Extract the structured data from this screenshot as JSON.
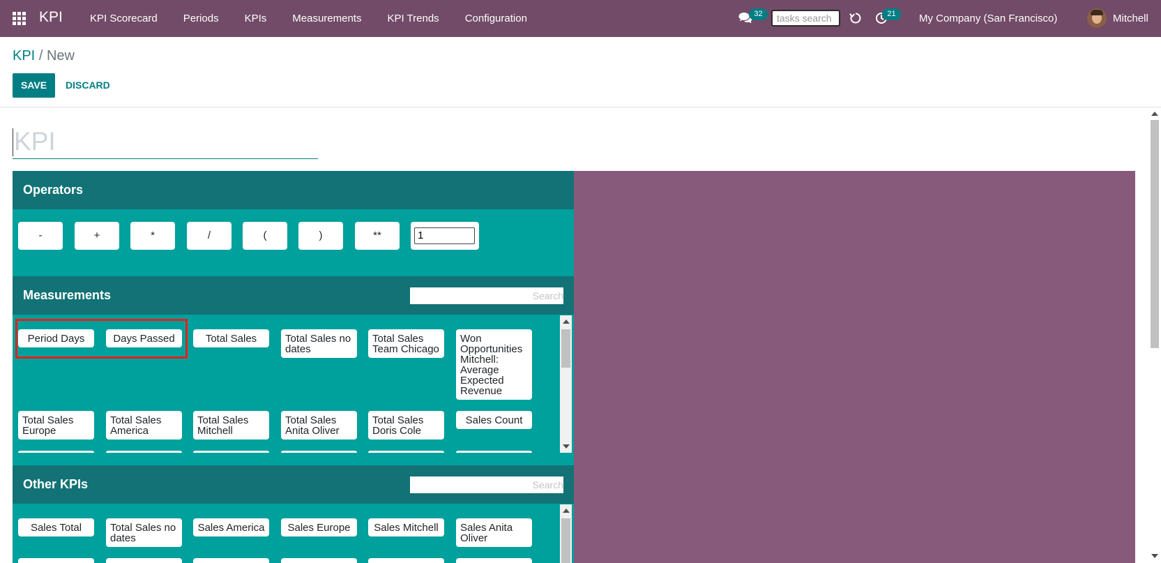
{
  "navbar": {
    "brand": "KPI",
    "menu": [
      "KPI Scorecard",
      "Periods",
      "KPIs",
      "Measurements",
      "KPI Trends",
      "Configuration"
    ],
    "messages_count": "32",
    "tasks_search_placeholder": "tasks search",
    "activities_count": "21",
    "company": "My Company (San Francisco)",
    "user": "Mitchell"
  },
  "breadcrumb": {
    "parent": "KPI",
    "separator": "/",
    "current": "New"
  },
  "buttons": {
    "save": "SAVE",
    "discard": "DISCARD"
  },
  "form": {
    "name_placeholder": "KPI"
  },
  "operators": {
    "title": "Operators",
    "buttons": [
      "-",
      "+",
      "*",
      "/",
      "(",
      ")",
      "**"
    ],
    "number_value": "1"
  },
  "measurements": {
    "title": "Measurements",
    "search_placeholder": "Search",
    "items": [
      "Period Days",
      "Days Passed",
      "Total Sales",
      "Total Sales no dates",
      "Total Sales Team Chicago",
      "Won Opportunities Mitchell: Average Expected Revenue",
      "Total Sales Europe",
      "Total Sales America",
      "Total Sales Mitchell",
      "Total Sales Anita Oliver",
      "Total Sales Doris Cole",
      "Sales Count"
    ]
  },
  "other_kpis": {
    "title": "Other KPIs",
    "search_placeholder": "Search",
    "items": [
      "Sales Total",
      "Total Sales no dates",
      "Sales America",
      "Sales Europe",
      "Sales Mitchell",
      "Sales Anita Oliver"
    ]
  },
  "colors": {
    "navbar": "#714b67",
    "primary": "#017e84",
    "panel": "#00a09d",
    "panel_header": "#127276",
    "formula_panel": "#875a7b",
    "highlight": "#e0221d"
  }
}
